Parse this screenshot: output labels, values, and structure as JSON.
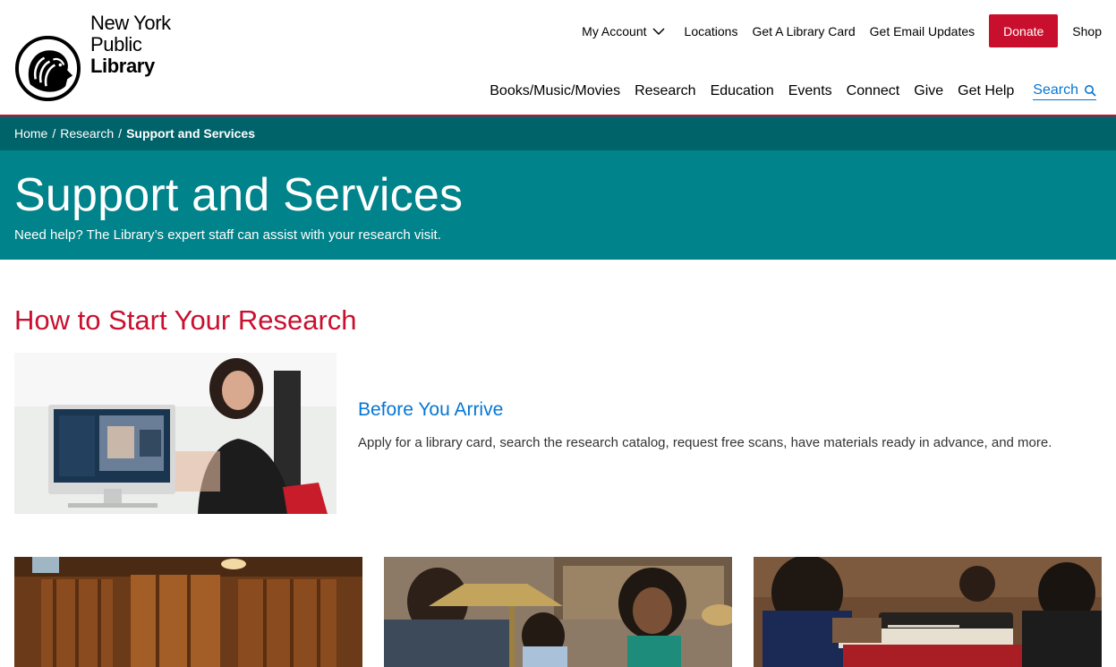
{
  "header": {
    "logo": {
      "line1": "New York",
      "line2": "Public",
      "line3": "Library"
    },
    "utility_nav": {
      "my_account": "My Account",
      "locations": "Locations",
      "library_card": "Get A Library Card",
      "email_updates": "Get Email Updates",
      "donate": "Donate",
      "shop": "Shop"
    },
    "main_nav": [
      "Books/Music/Movies",
      "Research",
      "Education",
      "Events",
      "Connect",
      "Give",
      "Get Help"
    ],
    "search_label": "Search"
  },
  "breadcrumb": {
    "home": "Home",
    "section": "Research",
    "current": "Support and Services"
  },
  "hero": {
    "title": "Support and Services",
    "subtitle": "Need help? The Library’s expert staff can assist with your research visit."
  },
  "section": {
    "title": "How to Start Your Research",
    "feature": {
      "title": "Before You Arrive",
      "description": "Apply for a library card, search the research catalog, request free scans, have materials ready in advance, and more."
    }
  },
  "colors": {
    "brand_red": "#c8102e",
    "teal_dark": "#00636a",
    "teal": "#00838a",
    "link_blue": "#0576d3"
  }
}
